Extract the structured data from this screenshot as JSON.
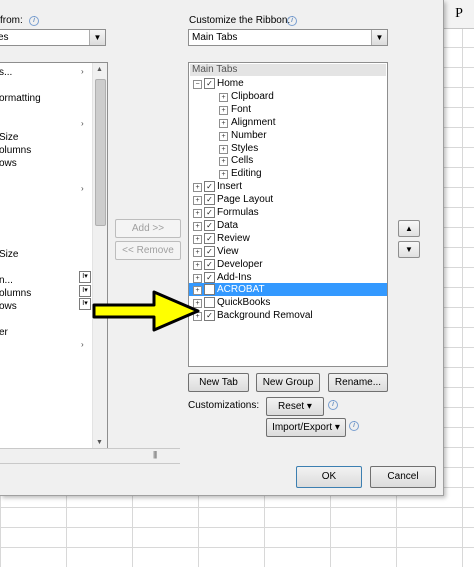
{
  "spreadsheet": {
    "column_header": "P"
  },
  "left": {
    "choose_label": "from:",
    "choose_value": "es",
    "items": [
      "s...",
      "",
      "ormatting",
      "",
      "",
      "Size",
      "olumns",
      "ows",
      "",
      "",
      "",
      "",
      "",
      "",
      "Size",
      "",
      "n...",
      "olumns",
      "ows",
      "",
      "er"
    ],
    "chevrons": [
      "›",
      "›",
      "›",
      "›"
    ]
  },
  "middle": {
    "add_label": "Add >>",
    "remove_label": "<< Remove"
  },
  "right": {
    "customize_label": "Customize the Ribbon:",
    "customize_value": "Main Tabs",
    "tree_header": "Main Tabs",
    "tree": [
      {
        "label": "Home",
        "expander": "−",
        "checked": true,
        "level": 0
      },
      {
        "label": "Clipboard",
        "expander": "+",
        "checked": null,
        "level": 1
      },
      {
        "label": "Font",
        "expander": "+",
        "checked": null,
        "level": 1
      },
      {
        "label": "Alignment",
        "expander": "+",
        "checked": null,
        "level": 1
      },
      {
        "label": "Number",
        "expander": "+",
        "checked": null,
        "level": 1
      },
      {
        "label": "Styles",
        "expander": "+",
        "checked": null,
        "level": 1
      },
      {
        "label": "Cells",
        "expander": "+",
        "checked": null,
        "level": 1
      },
      {
        "label": "Editing",
        "expander": "+",
        "checked": null,
        "level": 1
      },
      {
        "label": "Insert",
        "expander": "+",
        "checked": true,
        "level": 0
      },
      {
        "label": "Page Layout",
        "expander": "+",
        "checked": true,
        "level": 0
      },
      {
        "label": "Formulas",
        "expander": "+",
        "checked": true,
        "level": 0
      },
      {
        "label": "Data",
        "expander": "+",
        "checked": true,
        "level": 0
      },
      {
        "label": "Review",
        "expander": "+",
        "checked": true,
        "level": 0
      },
      {
        "label": "View",
        "expander": "+",
        "checked": true,
        "level": 0
      },
      {
        "label": "Developer",
        "expander": "+",
        "checked": true,
        "level": 0
      },
      {
        "label": "Add-Ins",
        "expander": "+",
        "checked": true,
        "level": 0
      },
      {
        "label": "ACROBAT",
        "expander": "+",
        "checked": false,
        "level": 0,
        "selected": true
      },
      {
        "label": "QuickBooks",
        "expander": "+",
        "checked": false,
        "level": 0
      },
      {
        "label": "Background Removal",
        "expander": "+",
        "checked": true,
        "level": 0
      }
    ],
    "new_tab": "New Tab",
    "new_group": "New Group",
    "rename": "Rename...",
    "customizations_label": "Customizations:",
    "reset_label": "Reset ▾",
    "import_export_label": "Import/Export ▾"
  },
  "footer": {
    "ok": "OK",
    "cancel": "Cancel"
  },
  "colors": {
    "selection": "#3399ff",
    "arrow_fill": "#ffff00"
  }
}
